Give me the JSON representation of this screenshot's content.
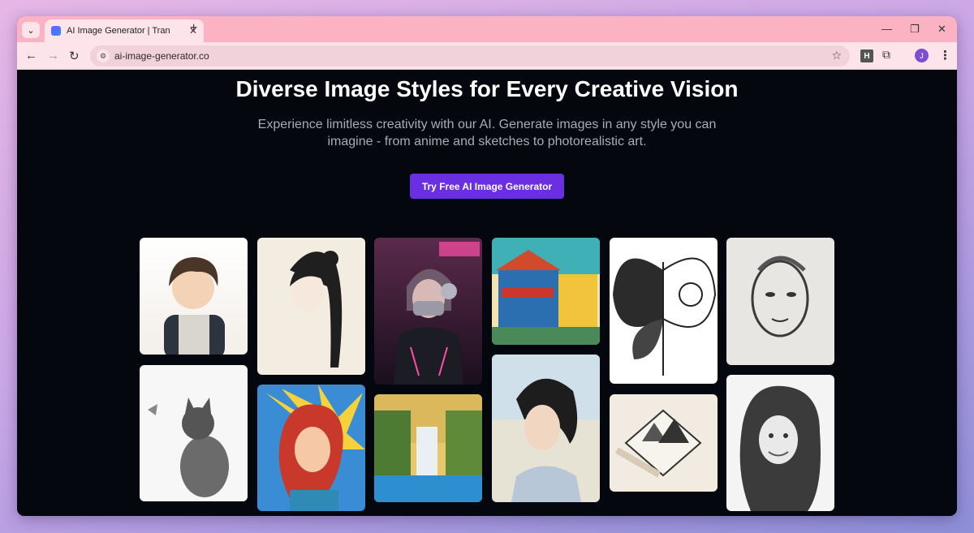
{
  "browser": {
    "tab_title": "AI Image Generator | Transform",
    "url": "ai-image-generator.co",
    "profile_initial": "J",
    "extension_label": "H",
    "icons": [
      "tab-search-icon",
      "favicon-icon",
      "close-tab-icon",
      "new-tab-icon",
      "minimize-icon",
      "restore-icon",
      "close-window-icon",
      "back-icon",
      "forward-icon",
      "reload-icon",
      "site-settings-icon",
      "bookmark-star-icon",
      "extensions-icon",
      "menu-icon"
    ]
  },
  "hero": {
    "title": "Diverse Image Styles for Every Creative Vision",
    "subtitle_line1": "Experience limitless creativity with our AI. Generate images in any style you can",
    "subtitle_line2": "imagine - from anime and sketches to photorealistic art.",
    "cta_label": "Try Free AI Image Generator"
  },
  "gallery": [
    {
      "name": "anime-boy"
    },
    {
      "name": "ink-woman"
    },
    {
      "name": "cyberpunk-girl"
    },
    {
      "name": "pop-art-storefront"
    },
    {
      "name": "butterfly-sketch"
    },
    {
      "name": "charcoal-face"
    },
    {
      "name": "pencil-cat"
    },
    {
      "name": "comic-woman"
    },
    {
      "name": "waterfall-painting"
    },
    {
      "name": "watercolor-girl"
    },
    {
      "name": "pen-landscape"
    },
    {
      "name": "pencil-portrait"
    }
  ],
  "colors": {
    "accent": "#6a2fe3",
    "background": "#05070f",
    "tabstrip": "#fbb3c3"
  }
}
